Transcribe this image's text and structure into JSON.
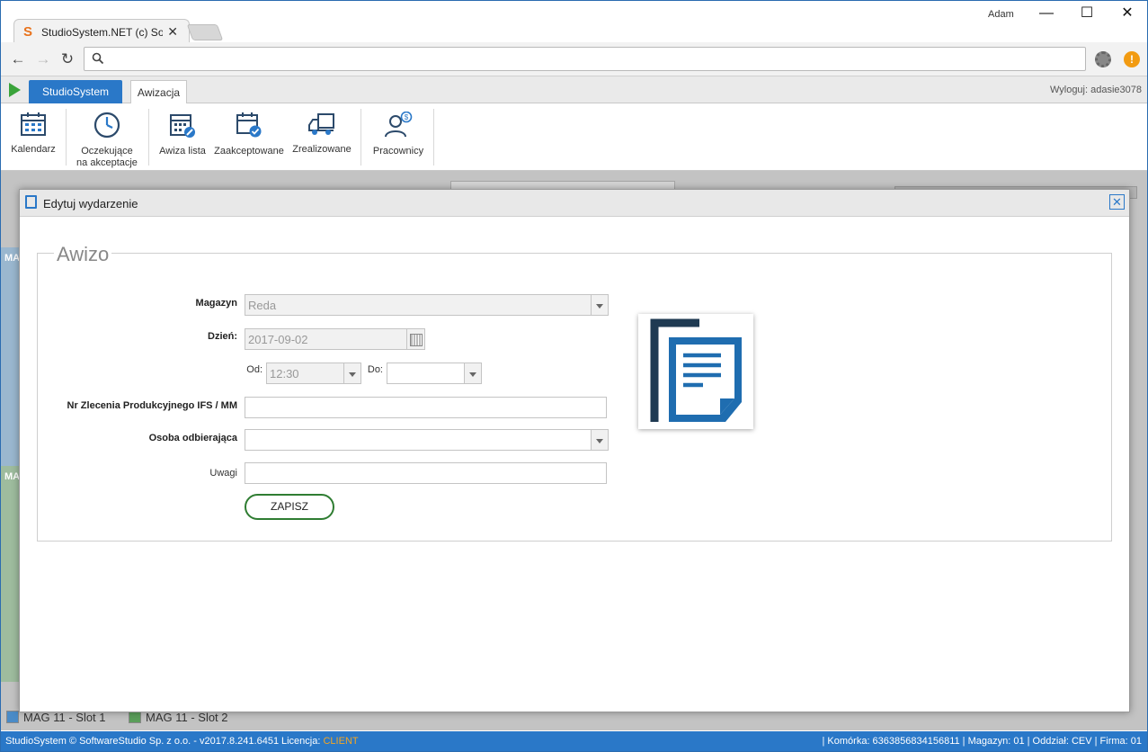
{
  "browser": {
    "tab_title": "StudioSystem.NET (c) Sof",
    "user": "Adam",
    "address_value": ""
  },
  "app": {
    "main_tab": "StudioSystem",
    "second_tab": "Awizacja",
    "logout": "Wyloguj: adasie3078"
  },
  "ribbon": [
    {
      "label": "Kalendarz",
      "icon": "calendar-icon"
    },
    {
      "label": "Oczekujące na akceptacje",
      "icon": "clock-icon"
    },
    {
      "label": "Awiza lista",
      "icon": "calendar-edit-icon"
    },
    {
      "label": "Zaakceptowane",
      "icon": "calendar-check-icon"
    },
    {
      "label": "Zrealizowane",
      "icon": "truck-icon"
    },
    {
      "label": "Pracownicy",
      "icon": "user-money-icon"
    }
  ],
  "background": {
    "label1": "MA",
    "label2": "MA",
    "legend": [
      {
        "label": "MAG 11 - Slot 1",
        "color": "#4a8bc7"
      },
      {
        "label": "MAG 11 - Slot 2",
        "color": "#5a9e5a"
      }
    ]
  },
  "status": {
    "left": "StudioSystem © SoftwareStudio Sp. z o.o. - v2017.8.241.6451",
    "license_label": "Licencja:",
    "license_value": "CLIENT",
    "right": "| Komórka: 6363856834156811 | Magazyn: 01 | Oddział: CEV | Firma: 01"
  },
  "modal": {
    "title": "Edytuj wydarzenie",
    "legend": "Awizo",
    "fields": {
      "magazyn_label": "Magazyn",
      "magazyn_value": "Reda",
      "dzien_label": "Dzień:",
      "dzien_value": "2017-09-02",
      "od_label": "Od:",
      "od_value": "12:30",
      "do_label": "Do:",
      "do_value": "",
      "nr_label": "Nr Zlecenia Produkcyjnego IFS / MM",
      "nr_value": "",
      "osoba_label": "Osoba odbierająca",
      "osoba_value": "",
      "uwagi_label": "Uwagi",
      "uwagi_value": ""
    },
    "save_label": "ZAPISZ"
  },
  "colors": {
    "accent": "#2a78c8",
    "save_border": "#2f7d32",
    "license_value": "#f5a623"
  }
}
